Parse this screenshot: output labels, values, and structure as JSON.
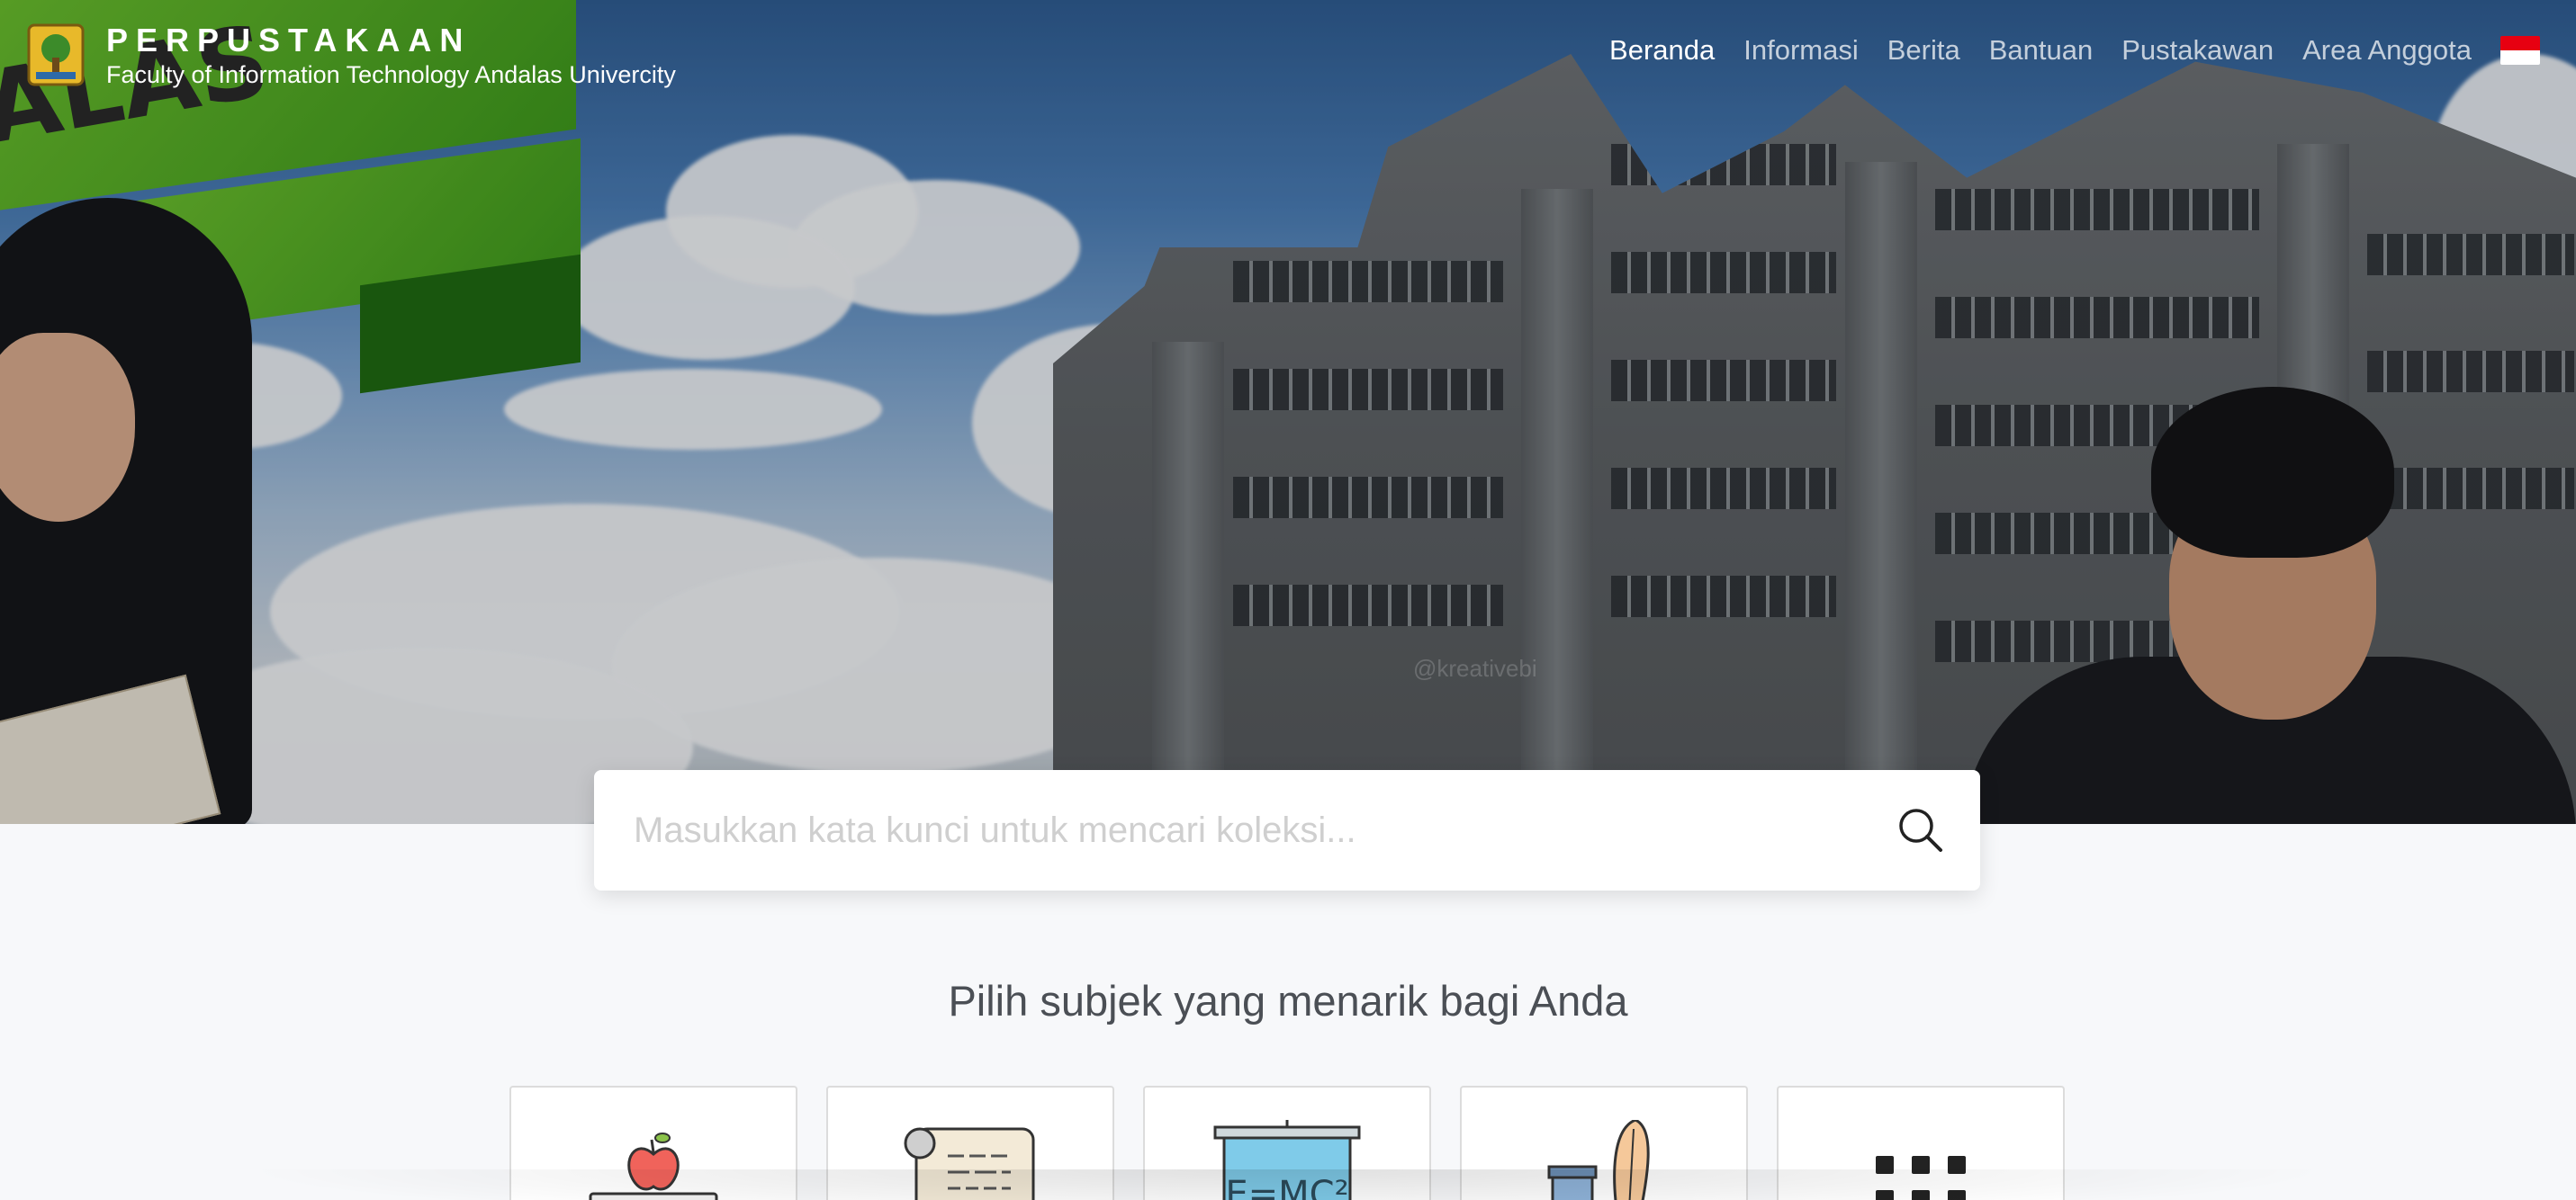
{
  "brand": {
    "title": "PERPUSTAKAAN",
    "subtitle": "Faculty of Information Technology Andalas Univercity",
    "banner_text": "ALAS"
  },
  "nav": {
    "items": [
      {
        "label": "Beranda",
        "active": true
      },
      {
        "label": "Informasi",
        "active": false
      },
      {
        "label": "Berita",
        "active": false
      },
      {
        "label": "Bantuan",
        "active": false
      },
      {
        "label": "Pustakawan",
        "active": false
      },
      {
        "label": "Area Anggota",
        "active": false
      }
    ],
    "language_flag": "indonesia-flag-icon"
  },
  "hero": {
    "watermark": "@kreativebi"
  },
  "search": {
    "placeholder": "Masukkan kata kunci untuk mencari koleksi..."
  },
  "subjects": {
    "heading": "Pilih subjek yang menarik bagi Anda",
    "cards": [
      {
        "icon": "apple-books-icon"
      },
      {
        "icon": "scroll-icon"
      },
      {
        "icon": "emc2-board-icon",
        "text": "E=MC²"
      },
      {
        "icon": "quill-ink-icon"
      },
      {
        "icon": "grid-more-icon"
      }
    ]
  },
  "colors": {
    "accent_green": "#4fa82a",
    "flag_red": "#e70011",
    "heading_text": "#4b4f55"
  }
}
